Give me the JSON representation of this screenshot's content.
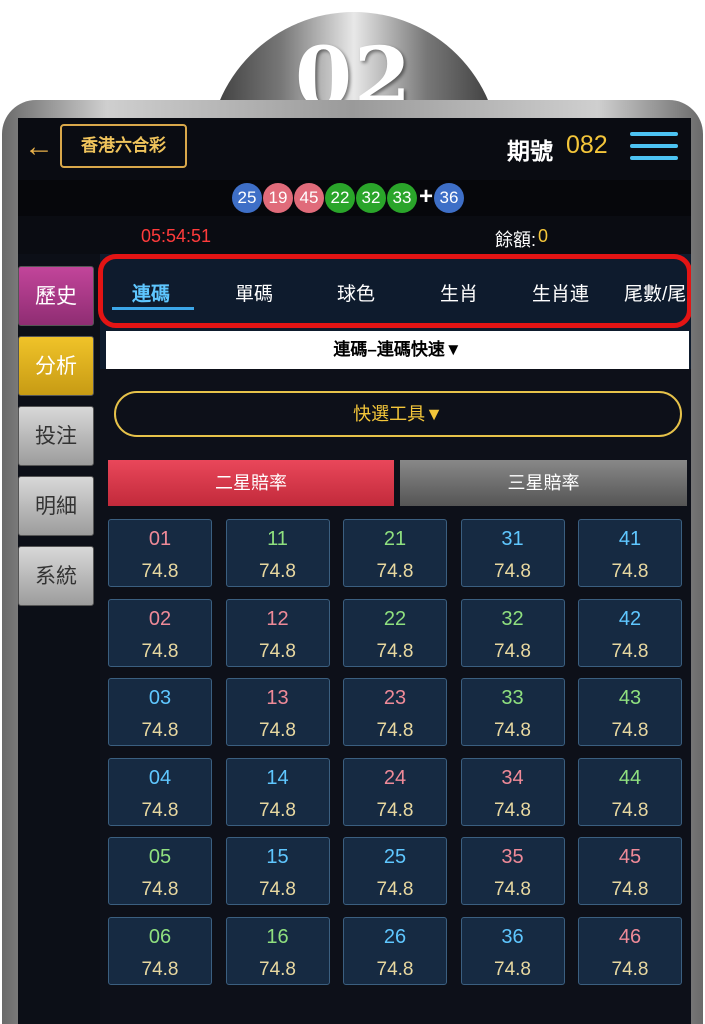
{
  "badge": {
    "text": "02"
  },
  "header": {
    "lottery_name": "香港六合彩",
    "period_label": "期號",
    "period_value": "082"
  },
  "results": {
    "balls": [
      {
        "num": "25",
        "color": "#3e6fc7"
      },
      {
        "num": "19",
        "color": "#e06b7a"
      },
      {
        "num": "45",
        "color": "#e06b7a"
      },
      {
        "num": "22",
        "color": "#2aa52a"
      },
      {
        "num": "32",
        "color": "#2aa52a"
      },
      {
        "num": "33",
        "color": "#2aa52a"
      }
    ],
    "plus": "+",
    "special": {
      "num": "36",
      "color": "#3e6fc7"
    }
  },
  "status": {
    "countdown": "05:54:51",
    "balance_label": "餘額:",
    "balance_value": "0"
  },
  "sidebar": {
    "history": "歷史",
    "analysis": "分析",
    "bet": "投注",
    "detail": "明細",
    "system": "系統"
  },
  "tabs": [
    "連碼",
    "單碼",
    "球色",
    "生肖",
    "生肖連",
    "尾數/尾"
  ],
  "subtype": "連碼–連碼快速▼",
  "quick_pick": "快選工具▼",
  "odds_tabs": {
    "two_star": "二星賠率",
    "three_star": "三星賠率"
  },
  "colors": {
    "red": "#ef8a98",
    "green": "#8fe07f",
    "blue": "#5fc7ff"
  },
  "grid": {
    "rows": [
      [
        {
          "num": "01",
          "color": "red",
          "odds": "74.8"
        },
        {
          "num": "11",
          "color": "green",
          "odds": "74.8"
        },
        {
          "num": "21",
          "color": "green",
          "odds": "74.8"
        },
        {
          "num": "31",
          "color": "blue",
          "odds": "74.8"
        },
        {
          "num": "41",
          "color": "blue",
          "odds": "74.8"
        }
      ],
      [
        {
          "num": "02",
          "color": "red",
          "odds": "74.8"
        },
        {
          "num": "12",
          "color": "red",
          "odds": "74.8"
        },
        {
          "num": "22",
          "color": "green",
          "odds": "74.8"
        },
        {
          "num": "32",
          "color": "green",
          "odds": "74.8"
        },
        {
          "num": "42",
          "color": "blue",
          "odds": "74.8"
        }
      ],
      [
        {
          "num": "03",
          "color": "blue",
          "odds": "74.8"
        },
        {
          "num": "13",
          "color": "red",
          "odds": "74.8"
        },
        {
          "num": "23",
          "color": "red",
          "odds": "74.8"
        },
        {
          "num": "33",
          "color": "green",
          "odds": "74.8"
        },
        {
          "num": "43",
          "color": "green",
          "odds": "74.8"
        }
      ],
      [
        {
          "num": "04",
          "color": "blue",
          "odds": "74.8"
        },
        {
          "num": "14",
          "color": "blue",
          "odds": "74.8"
        },
        {
          "num": "24",
          "color": "red",
          "odds": "74.8"
        },
        {
          "num": "34",
          "color": "red",
          "odds": "74.8"
        },
        {
          "num": "44",
          "color": "green",
          "odds": "74.8"
        }
      ],
      [
        {
          "num": "05",
          "color": "green",
          "odds": "74.8"
        },
        {
          "num": "15",
          "color": "blue",
          "odds": "74.8"
        },
        {
          "num": "25",
          "color": "blue",
          "odds": "74.8"
        },
        {
          "num": "35",
          "color": "red",
          "odds": "74.8"
        },
        {
          "num": "45",
          "color": "red",
          "odds": "74.8"
        }
      ],
      [
        {
          "num": "06",
          "color": "green",
          "odds": "74.8"
        },
        {
          "num": "16",
          "color": "green",
          "odds": "74.8"
        },
        {
          "num": "26",
          "color": "blue",
          "odds": "74.8"
        },
        {
          "num": "36",
          "color": "blue",
          "odds": "74.8"
        },
        {
          "num": "46",
          "color": "red",
          "odds": "74.8"
        }
      ]
    ]
  }
}
